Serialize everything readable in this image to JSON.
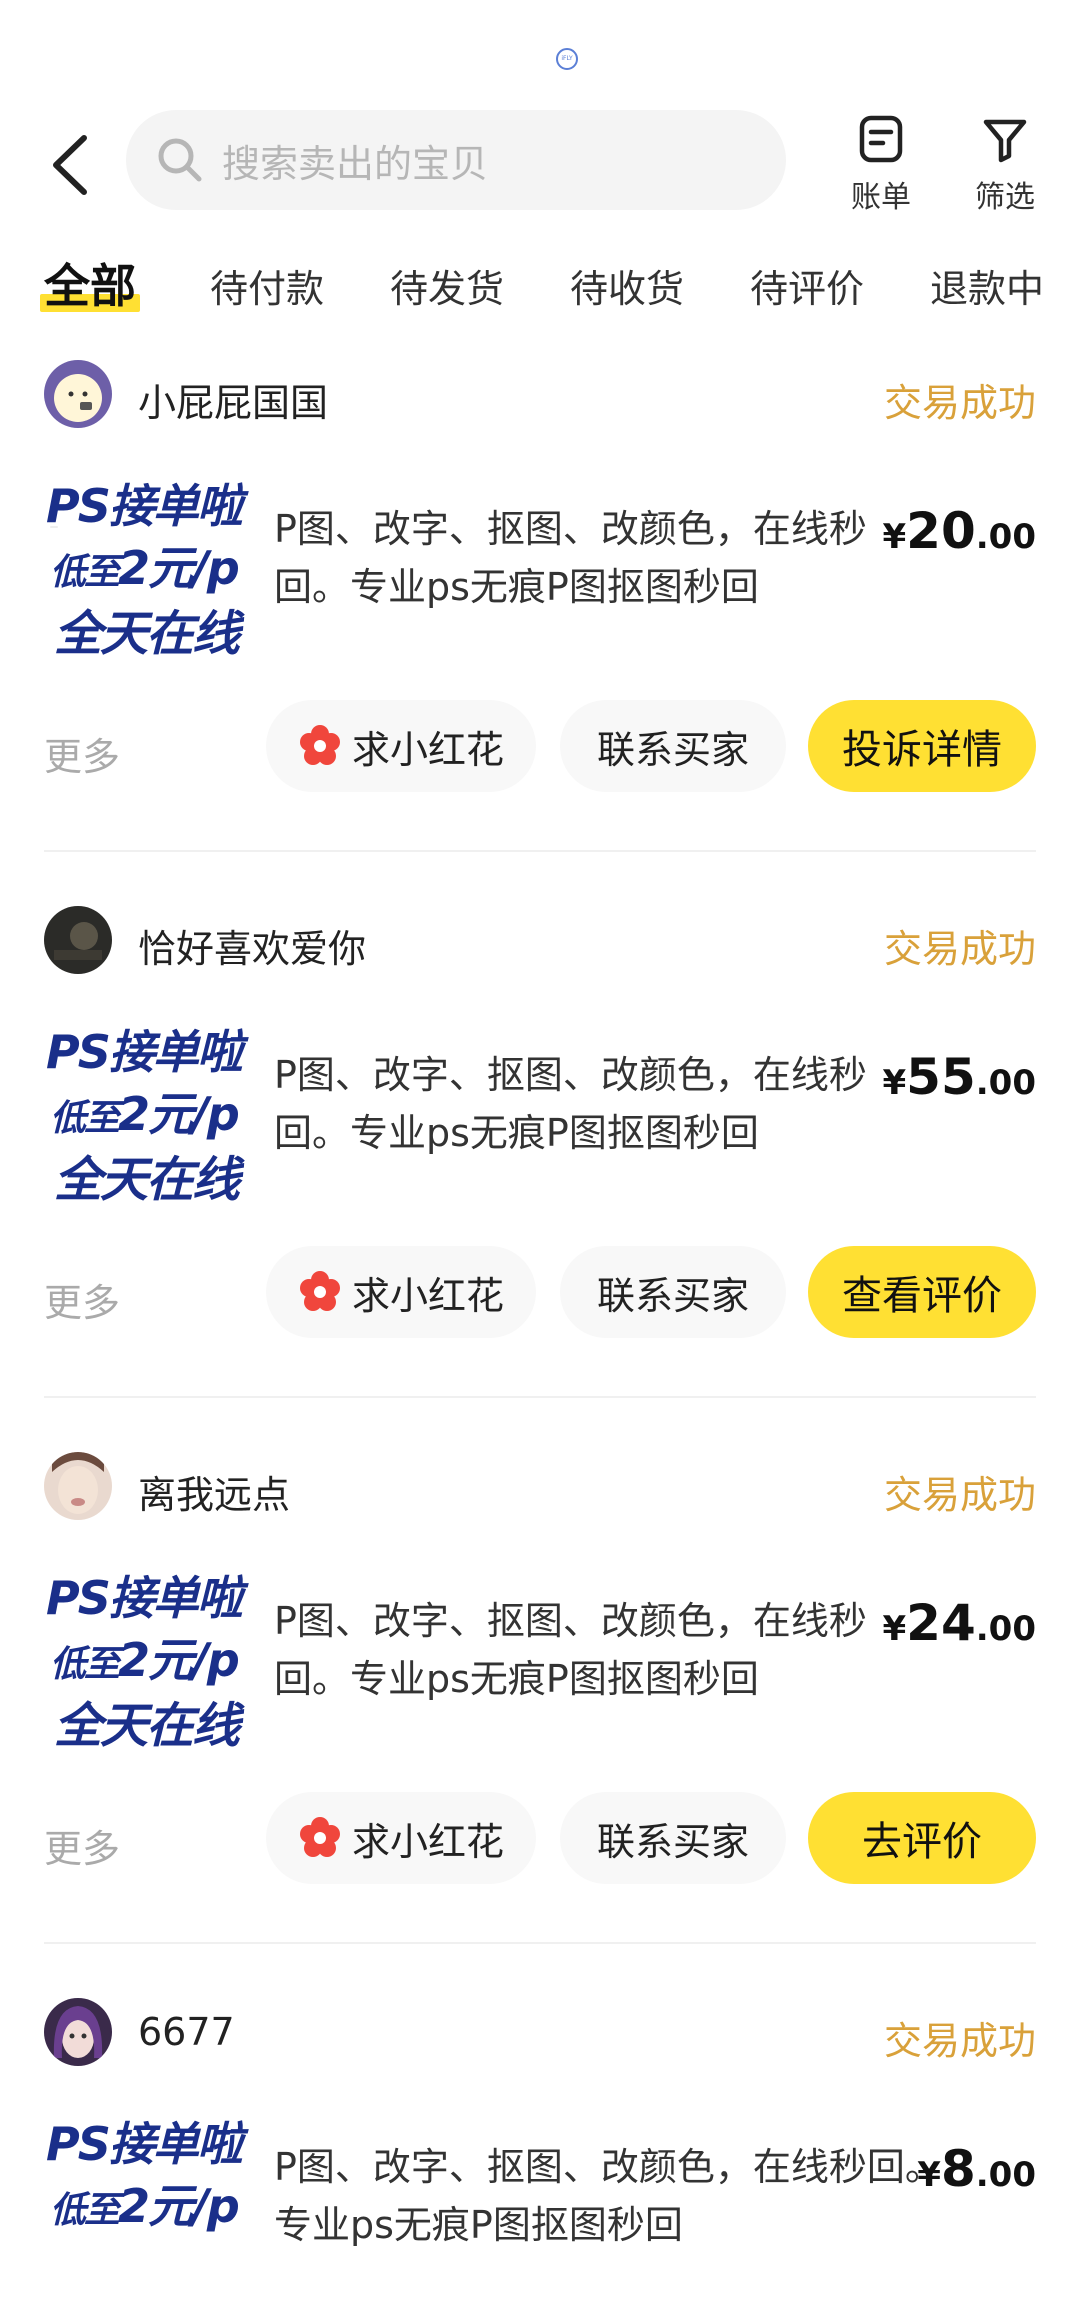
{
  "status_bar": {
    "indicator_text": "iFLY"
  },
  "header": {
    "search_placeholder": "搜索卖出的宝贝",
    "bill_label": "账单",
    "filter_label": "筛选"
  },
  "tabs": [
    {
      "label": "全部",
      "active": true
    },
    {
      "label": "待付款"
    },
    {
      "label": "待发货"
    },
    {
      "label": "待收货"
    },
    {
      "label": "待评价"
    },
    {
      "label": "退款中"
    }
  ],
  "thumbnail": {
    "line1": "PS接单啦",
    "line2_prefix": "低至",
    "line2_main": "2元/p",
    "line3": "全天在线"
  },
  "orders": [
    {
      "buyer": "小屁屁国国",
      "status": "交易成功",
      "description": "P图、改字、抠图、改颜色，在线秒回。专业ps无痕P图抠图秒回",
      "price_currency": "¥",
      "price_int": "20",
      "price_dec": ".00",
      "more_label": "更多",
      "flower_label": "求小红花",
      "contact_label": "联系买家",
      "primary_label": "投诉详情"
    },
    {
      "buyer": "恰好喜欢爱你",
      "status": "交易成功",
      "description": "P图、改字、抠图、改颜色，在线秒回。专业ps无痕P图抠图秒回",
      "price_currency": "¥",
      "price_int": "55",
      "price_dec": ".00",
      "more_label": "更多",
      "flower_label": "求小红花",
      "contact_label": "联系买家",
      "primary_label": "查看评价"
    },
    {
      "buyer": "离我远点",
      "status": "交易成功",
      "description": "P图、改字、抠图、改颜色，在线秒回。专业ps无痕P图抠图秒回",
      "price_currency": "¥",
      "price_int": "24",
      "price_dec": ".00",
      "more_label": "更多",
      "flower_label": "求小红花",
      "contact_label": "联系买家",
      "primary_label": "去评价"
    },
    {
      "buyer": "6677",
      "status": "交易成功",
      "description": "P图、改字、抠图、改颜色，在线秒回。专业ps无痕P图抠图秒回",
      "price_currency": "¥",
      "price_int": "8",
      "price_dec": ".00"
    }
  ],
  "colors": {
    "accent_yellow": "#ffe033",
    "status_gold": "#d9a13a",
    "flower_red": "#f0463c"
  }
}
